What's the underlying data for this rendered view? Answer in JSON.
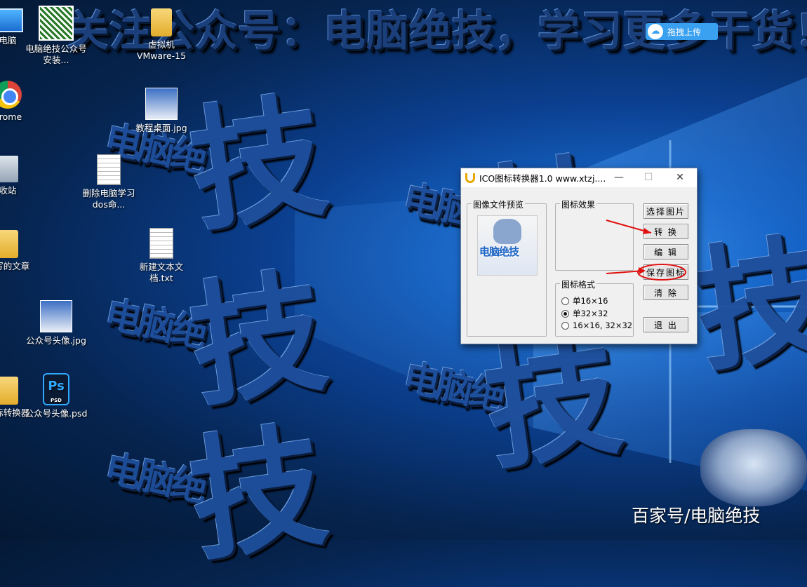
{
  "banner": {
    "text": "关注公众号：电脑绝技，学习更多干货！"
  },
  "watermarks": {
    "small": "电脑绝",
    "big": "技"
  },
  "desktop_icons": [
    {
      "label": "电脑"
    },
    {
      "label": "电脑绝技公众号安装..."
    },
    {
      "label": "虚拟机VMware-15"
    },
    {
      "label": "hrome"
    },
    {
      "label": "教程桌面.jpg"
    },
    {
      "label": "收站"
    },
    {
      "label": "删除电脑学习dos命..."
    },
    {
      "label": "体写的文章"
    },
    {
      "label": "新建文本文档.txt"
    },
    {
      "label": "公众号头像.jpg"
    },
    {
      "label": "图标转换器"
    },
    {
      "label": "公众号头像.psd"
    }
  ],
  "upload_button": {
    "label": "拖拽上传",
    "icon": "cloud-upload-icon"
  },
  "dialog": {
    "title": "ICO图标转换器1.0  www.xtzj....",
    "titlebar_buttons": {
      "minimize": "—",
      "maximize": "☐",
      "close": "✕"
    },
    "preview_group": "图像文件预览",
    "preview_text": "电脑绝技",
    "effect_group": "图标效果",
    "format_group": "图标格式",
    "formats": [
      {
        "label": "单16×16",
        "selected": false
      },
      {
        "label": "单32×32",
        "selected": true
      },
      {
        "label": "16×16, 32×32",
        "selected": false
      }
    ],
    "buttons": {
      "select": "选择图片",
      "convert": "转  换",
      "edit": "编  辑",
      "save": "保存图标",
      "clear": "清  除",
      "exit": "退  出"
    }
  },
  "footer": {
    "text": "百家号/电脑绝技"
  }
}
